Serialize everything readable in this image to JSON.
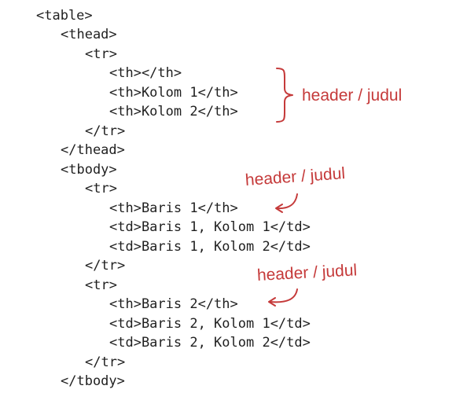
{
  "code": {
    "lines": [
      "<table>",
      "<thead>",
      "<tr>",
      "<th></th>",
      "<th>Kolom 1</th>",
      "<th>Kolom 2</th>",
      "</tr>",
      "</thead>",
      "<tbody>",
      "<tr>",
      "<th>Baris 1</th>",
      "<td>Baris 1, Kolom 1</td>",
      "<td>Baris 1, Kolom 2</td>",
      "</tr>",
      "<tr>",
      "<th>Baris 2</th>",
      "<td>Baris 2, Kolom 1</td>",
      "<td>Baris 2, Kolom 2</td>",
      "</tr>",
      "</tbody>"
    ]
  },
  "annotations": {
    "thead_label": "header / judul",
    "row1_label": "header / judul",
    "row2_label": "header / judul"
  },
  "colors": {
    "annotation": "#c53a3a",
    "code": "#1f1f1f"
  }
}
